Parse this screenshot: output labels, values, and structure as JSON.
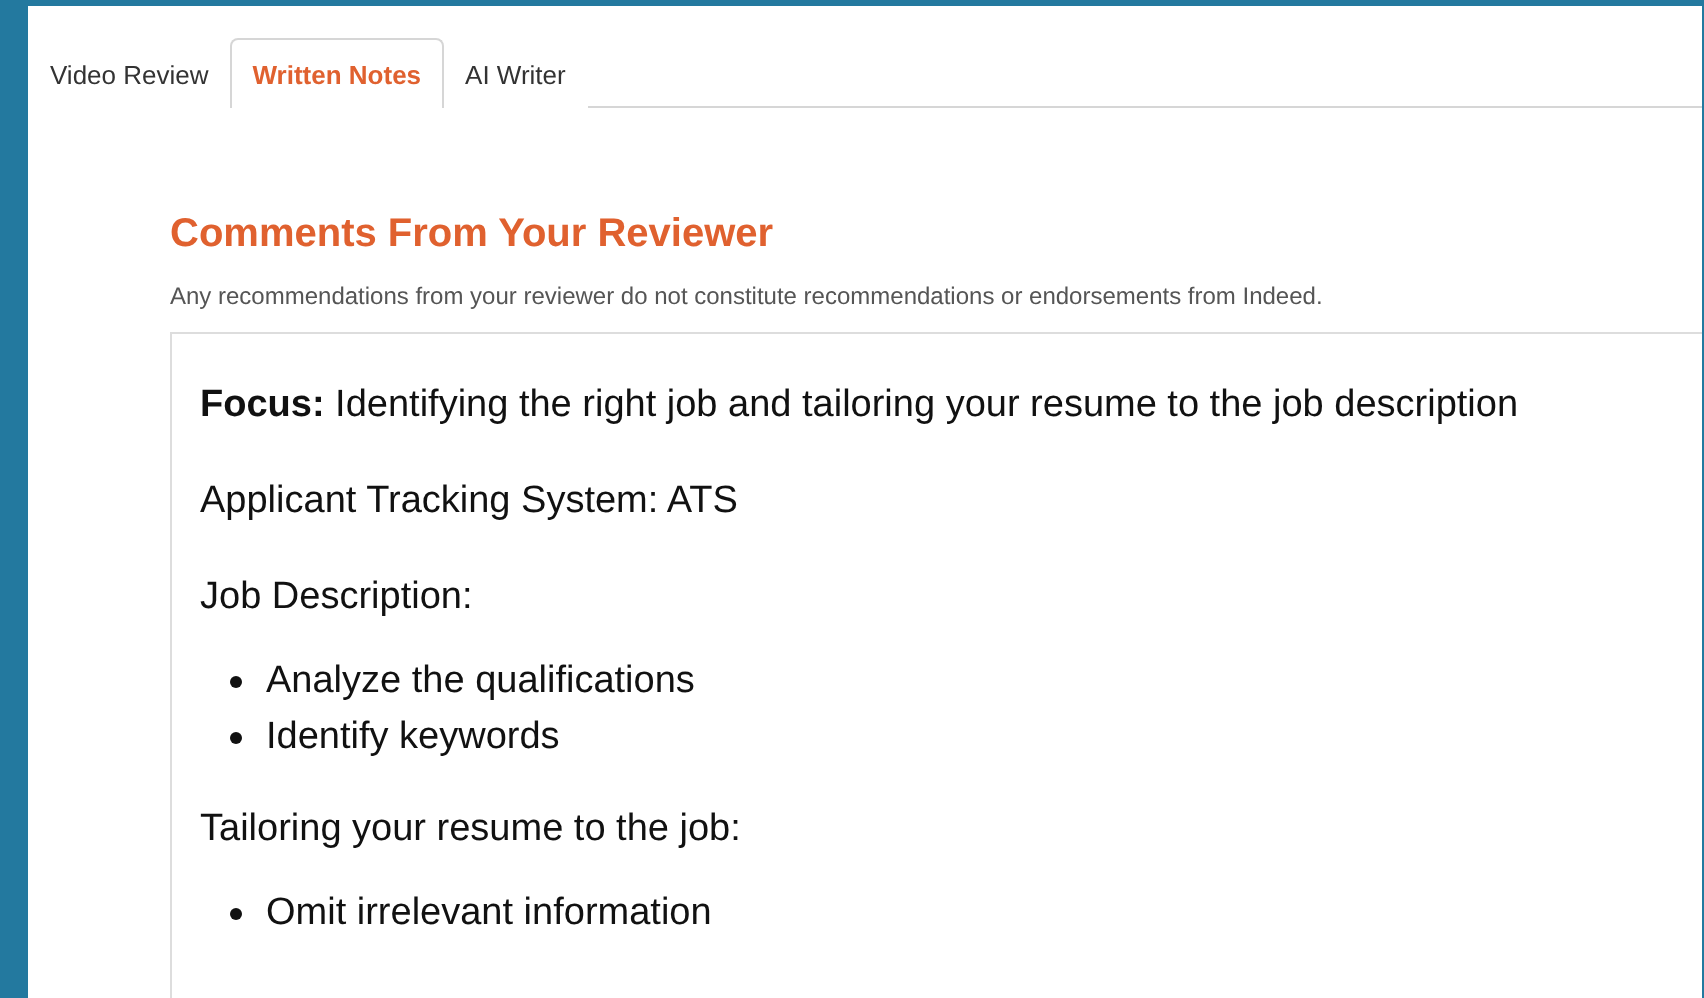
{
  "tabs": [
    {
      "label": "Video Review",
      "selected": false
    },
    {
      "label": "Written Notes",
      "selected": true
    },
    {
      "label": "AI Writer",
      "selected": false
    }
  ],
  "section": {
    "title": "Comments From Your Reviewer",
    "disclaimer": "Any recommendations from your reviewer do not constitute recommendations or endorsements from Indeed."
  },
  "notes": [
    {
      "kind": "paragraph",
      "text": "**Focus:** Identifying the right job and tailoring your resume to the job description"
    },
    {
      "kind": "paragraph",
      "text": "Applicant Tracking System: ATS"
    },
    {
      "kind": "paragraph",
      "text": "Job Description:"
    },
    {
      "kind": "list",
      "items": [
        "Analyze the qualifications",
        "Identify keywords"
      ]
    },
    {
      "kind": "paragraph",
      "text": "Tailoring your resume to the job:"
    },
    {
      "kind": "list",
      "items": [
        "Omit irrelevant information"
      ]
    }
  ]
}
